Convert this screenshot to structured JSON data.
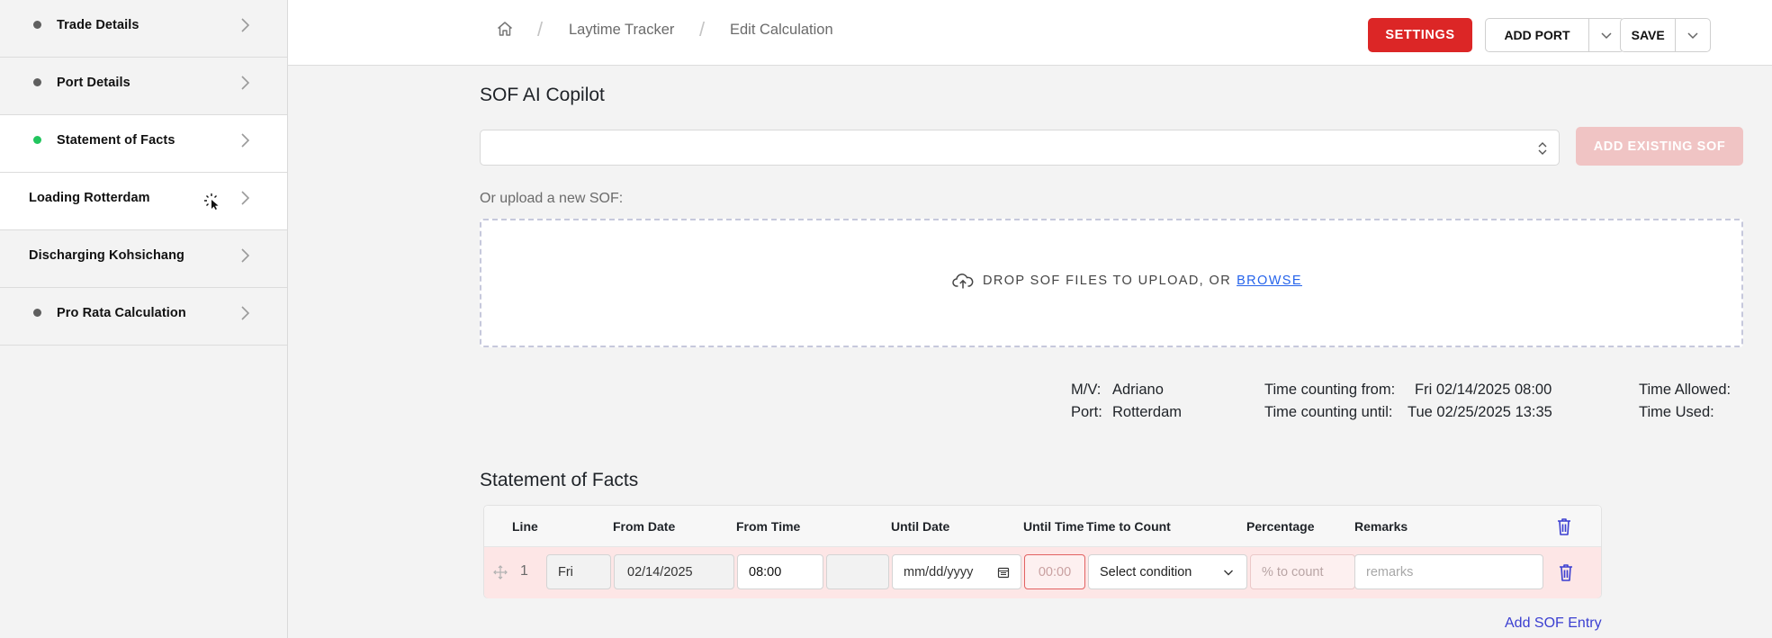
{
  "sidebar": {
    "items": [
      {
        "label": "Trade Details",
        "dot": "#5f5f5f"
      },
      {
        "label": "Port Details",
        "dot": "#5f5f5f"
      },
      {
        "label": "Statement of Facts",
        "dot": "#22c55e"
      },
      {
        "label": "Loading Rotterdam"
      },
      {
        "label": "Discharging Kohsichang"
      },
      {
        "label": "Pro Rata Calculation",
        "dot": "#5f5f5f"
      }
    ]
  },
  "header": {
    "breadcrumb": [
      "Laytime Tracker",
      "Edit Calculation"
    ],
    "settings_label": "SETTINGS",
    "add_port_label": "ADD PORT",
    "save_label": "SAVE"
  },
  "copilot": {
    "title": "SOF AI Copilot",
    "select_value": "",
    "add_existing_label": "ADD EXISTING SOF",
    "upload_label": "Or upload a new SOF:",
    "drop_text": "DROP SOF FILES TO UPLOAD, OR",
    "browse_label": "BROWSE"
  },
  "info": {
    "mv_label": "M/V:",
    "mv_value": "Adriano",
    "port_label": "Port:",
    "port_value": "Rotterdam",
    "from_label": "Time counting from:",
    "from_value": "Fri 02/14/2025 08:00",
    "until_label": "Time counting until:",
    "until_value": "Tue 02/25/2025 13:35",
    "allowed_label": "Time Allowed:",
    "used_label": "Time Used:"
  },
  "sof": {
    "title": "Statement of Facts",
    "columns": [
      "Line",
      "From Date",
      "From Time",
      "Until Date",
      "Until Time",
      "Time to Count",
      "Percentage",
      "Remarks"
    ],
    "rows": [
      {
        "line": "1",
        "day": "Fri",
        "from_date": "02/14/2025",
        "from_time": "08:00",
        "until_date_placeholder": "mm/dd/yyyy",
        "until_time_placeholder": "00:00",
        "condition": "Select condition",
        "percentage_placeholder": "% to count",
        "remarks_placeholder": "remarks"
      }
    ],
    "add_entry_label": "Add SOF Entry"
  },
  "colors": {
    "accent_red": "#dc2626",
    "active_dot": "#22c55e",
    "link": "#3b3fd1",
    "row_error_bg": "#fde6e6"
  }
}
